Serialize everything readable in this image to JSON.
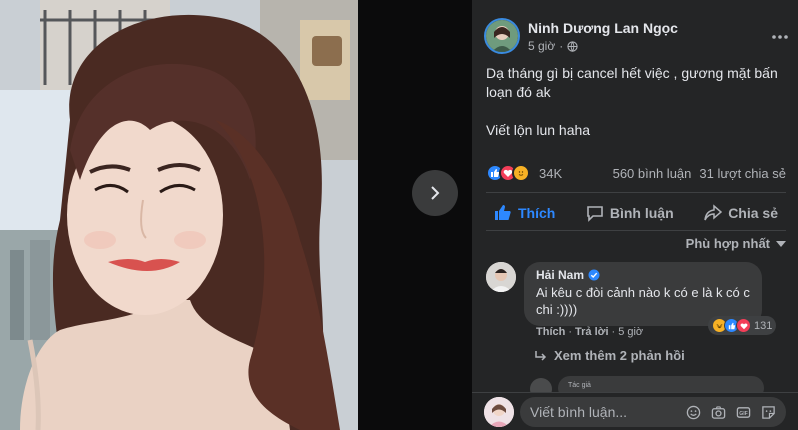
{
  "post": {
    "author": "Ninh Dương Lan Ngọc",
    "time": "5 giờ",
    "privacy_icon": "globe-icon",
    "text_line1": "Dạ tháng gì bị cancel hết việc , gương mặt bấn loạn đó ak",
    "text_line2": "Viết lộn lun haha",
    "reactions_count": "34K",
    "comments_count": "560 bình luận",
    "shares_count": "31 lượt chia sẻ",
    "reaction_icons": [
      "like-icon",
      "love-icon",
      "care-icon"
    ]
  },
  "actions": {
    "like": "Thích",
    "comment": "Bình luận",
    "share": "Chia sẻ"
  },
  "sort": {
    "label": "Phù hợp nhất"
  },
  "comment": {
    "name": "Hải Nam",
    "text": "Ai kêu c đòi cảnh nào k có e là k có c chi :))))",
    "like": "Thích",
    "separator1": "·",
    "reply": "Trả lời",
    "separator2": "·",
    "time": "5 giờ",
    "reaction_count": "131",
    "view_more": "Xem thêm 2 phản hồi"
  },
  "next_comment": {
    "snippet": "Tác giả"
  },
  "compose": {
    "placeholder": "Viết bình luận..."
  },
  "colors": {
    "accent": "#2d88ff",
    "panel_bg": "#242526",
    "viewer_bg": "#18191a"
  }
}
